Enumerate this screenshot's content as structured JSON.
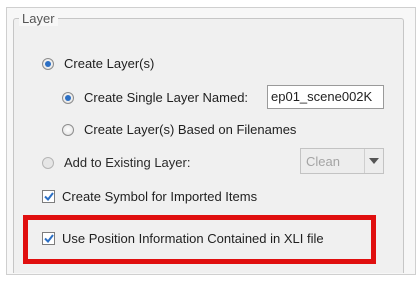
{
  "layer_group": {
    "title": "Layer",
    "create_layers": {
      "label": "Create Layer(s)",
      "selected": true
    },
    "create_single_layer": {
      "label": "Create Single Layer Named:",
      "selected": true,
      "name_value": "ep01_scene002K"
    },
    "create_layers_from_filenames": {
      "label": "Create Layer(s) Based on Filenames",
      "selected": false
    },
    "add_to_existing": {
      "label": "Add to Existing Layer:",
      "selected": false,
      "dropdown_value": "Clean"
    },
    "create_symbol": {
      "label": "Create Symbol for Imported Items",
      "checked": true
    },
    "use_position_info": {
      "label": "Use Position Information Contained in XLI file",
      "checked": true
    }
  },
  "colors": {
    "accent_blue": "#2b6fc4",
    "highlight_red": "#e00f0f"
  },
  "icons": {
    "checkmark": "checkmark-icon",
    "dropdown": "chevron-down-icon"
  }
}
